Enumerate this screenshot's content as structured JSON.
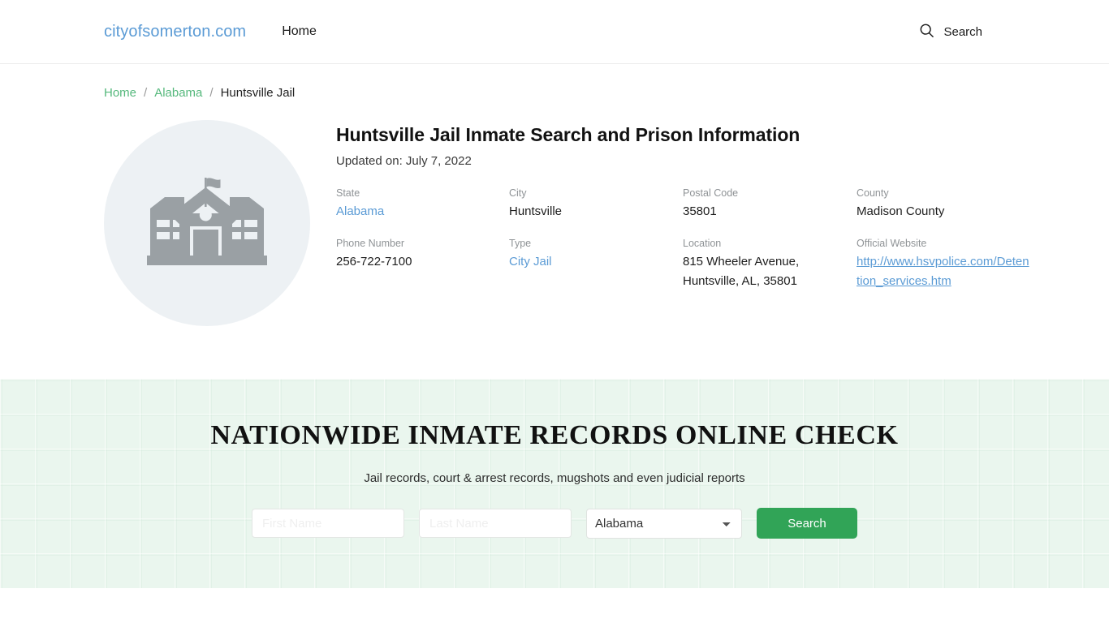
{
  "header": {
    "brand": "cityofsomerton.com",
    "nav_home": "Home",
    "search_label": "Search",
    "search_icon": "search-icon"
  },
  "breadcrumb": {
    "home": "Home",
    "separator": "/",
    "state": "Alabama",
    "current": "Huntsville Jail"
  },
  "detail": {
    "thumbnail_icon": "building-school-icon",
    "title": "Huntsville Jail Inmate Search and Prison Information",
    "updated": "Updated on: July 7, 2022",
    "fields": [
      {
        "label": "State",
        "value": "Alabama",
        "style": "link"
      },
      {
        "label": "City",
        "value": "Huntsville",
        "style": "text"
      },
      {
        "label": "Postal Code",
        "value": "35801",
        "style": "text"
      },
      {
        "label": "County",
        "value": "Madison County",
        "style": "text"
      },
      {
        "label": "Phone Number",
        "value": "256-722-7100",
        "style": "text"
      },
      {
        "label": "Type",
        "value": "City Jail",
        "style": "link"
      },
      {
        "label": "Location",
        "value": "815 Wheeler Avenue, Huntsville, AL, 35801",
        "style": "text"
      },
      {
        "label": "Official Website",
        "value": "http://www.hsvpolice.com/Detention_services.htm",
        "style": "url"
      }
    ]
  },
  "promo": {
    "title": "NATIONWIDE INMATE RECORDS ONLINE CHECK",
    "subtitle": "Jail records, court & arrest records, mugshots and even judicial reports",
    "first_name_placeholder": "First Name",
    "first_name_value": "",
    "last_name_placeholder": "Last Name",
    "last_name_value": "",
    "state_selected": "Alabama",
    "state_options": [
      "Alabama"
    ],
    "search_button": "Search"
  },
  "colors": {
    "brand_blue": "#5b9bd5",
    "breadcrumb_green": "#55b87c",
    "promo_bg": "#eaf6ee",
    "button_green": "#31a457",
    "thumb_bg": "#edf1f4",
    "icon_gray": "#9aa0a4"
  }
}
